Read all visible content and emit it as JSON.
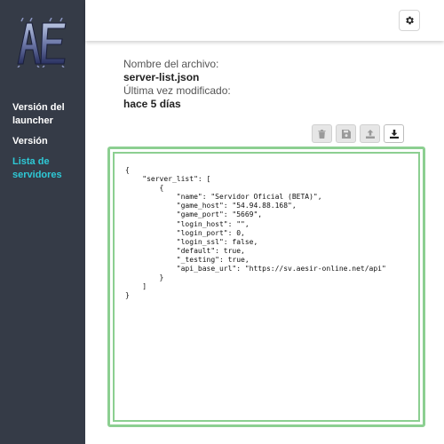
{
  "app": {
    "logo_text": "AE"
  },
  "sidebar": {
    "items": [
      {
        "label": "Versión del launcher",
        "active": false
      },
      {
        "label": "Versión",
        "active": false
      },
      {
        "label": "Lista de servidores",
        "active": true
      }
    ]
  },
  "topbar": {
    "settings_icon": "gear-icon"
  },
  "file": {
    "name_label": "Nombre del archivo:",
    "name": "server-list.json",
    "modified_label": "Última vez modificado:",
    "modified": "hace 5 días"
  },
  "toolbar": {
    "buttons": [
      {
        "icon": "trash-icon",
        "enabled": false
      },
      {
        "icon": "save-icon",
        "enabled": false
      },
      {
        "icon": "upload-icon",
        "enabled": false
      },
      {
        "icon": "download-icon",
        "enabled": true
      }
    ]
  },
  "editor": {
    "lines": [
      "{",
      "    \"server_list\": [",
      "        {",
      "            \"name\": \"Servidor Oficial (BETA)\",",
      "            \"game_host\": \"54.94.88.168\",",
      "            \"game_port\": \"5669\",",
      "            \"login_host\": \"\",",
      "            \"login_port\": 0,",
      "            \"login_ssl\": false,",
      "            \"default\": true,",
      "            \"_testing\": true,",
      "            \"api_base_url\": \"https://sv.aesir-online.net/api\"",
      "        }",
      "    ]",
      "}"
    ]
  },
  "colors": {
    "sidebar_bg": "#353b47",
    "active_nav": "#2ec9d6",
    "editor_border": "#8ccf91"
  }
}
